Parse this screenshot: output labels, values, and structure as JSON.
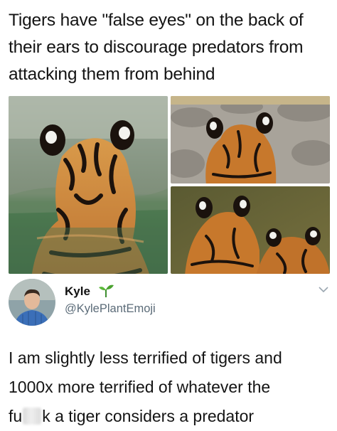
{
  "post": {
    "headline_line1": "Tigers have \"false eyes\" on the back of",
    "headline_line2": "their ears to discourage predators from",
    "headline_line3": "attacking them from behind"
  },
  "photos": {
    "left": "tiger-in-water-photo",
    "top_right": "tiger-on-rocks-photo",
    "bottom_right": "two-tigers-ears-photo"
  },
  "tweet": {
    "author_name": "Kyle",
    "author_badge": "sprout-emoji",
    "handle": "@KylePlantEmoji",
    "line1": "I am slightly less terrified of tigers and",
    "line2": "1000x more terrified of whatever the",
    "line3_start": "fu",
    "line3_end": "k a tiger considers a predator"
  },
  "colors": {
    "text": "#141414",
    "handle": "#5b6b78",
    "tiger_orange": "#c7782c",
    "stripe": "#1c120c"
  }
}
